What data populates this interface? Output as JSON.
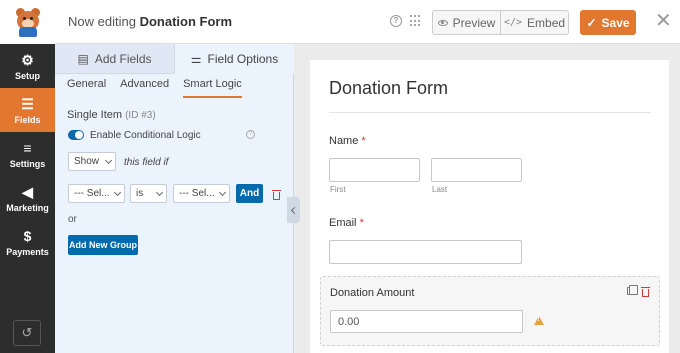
{
  "header": {
    "editing_prefix": "Now editing",
    "form_name": "Donation Form",
    "preview_label": "Preview",
    "embed_label": "Embed",
    "save_label": "Save",
    "icons": [
      "help-icon",
      "grid-icon",
      "eye-icon",
      "code-icon",
      "check-icon",
      "close-icon"
    ]
  },
  "nav": {
    "items": [
      {
        "label": "Setup",
        "icon": "gear-icon"
      },
      {
        "label": "Fields",
        "icon": "fields-list-icon",
        "active": true
      },
      {
        "label": "Settings",
        "icon": "sliders-icon"
      },
      {
        "label": "Marketing",
        "icon": "megaphone-icon"
      },
      {
        "label": "Payments",
        "icon": "dollar-icon"
      }
    ],
    "bottom_icon": "history-icon"
  },
  "panel": {
    "tabs": [
      {
        "label": "Add Fields",
        "icon": "list-icon"
      },
      {
        "label": "Field Options",
        "icon": "sliders-icon",
        "active": true
      }
    ],
    "subtabs": [
      "General",
      "Advanced",
      "Smart Logic"
    ],
    "active_subtab": "Smart Logic",
    "field_name": "Single Item",
    "field_id": "(ID #3)",
    "toggle_label": "Enable Conditional Logic",
    "toggle_on": true,
    "show_value": "Show",
    "this_field_if": "this field if",
    "rule": {
      "field_value": "--- Sel...",
      "operator_value": "is",
      "value_value": "--- Sel...",
      "and_label": "And"
    },
    "or_label": "or",
    "add_group_label": "Add New Group"
  },
  "preview": {
    "form_title": "Donation Form",
    "name_label": "Name",
    "required_mark": "*",
    "first_label": "First",
    "last_label": "Last",
    "email_label": "Email",
    "donation_label": "Donation Amount",
    "donation_value": "0.00"
  },
  "colors": {
    "accent": "#e27730",
    "primary_blue": "#036aab",
    "danger": "#d63638",
    "warning": "#e6a23c",
    "nav_bg": "#2d2d2d",
    "panel_bg": "#ebf3fc"
  }
}
